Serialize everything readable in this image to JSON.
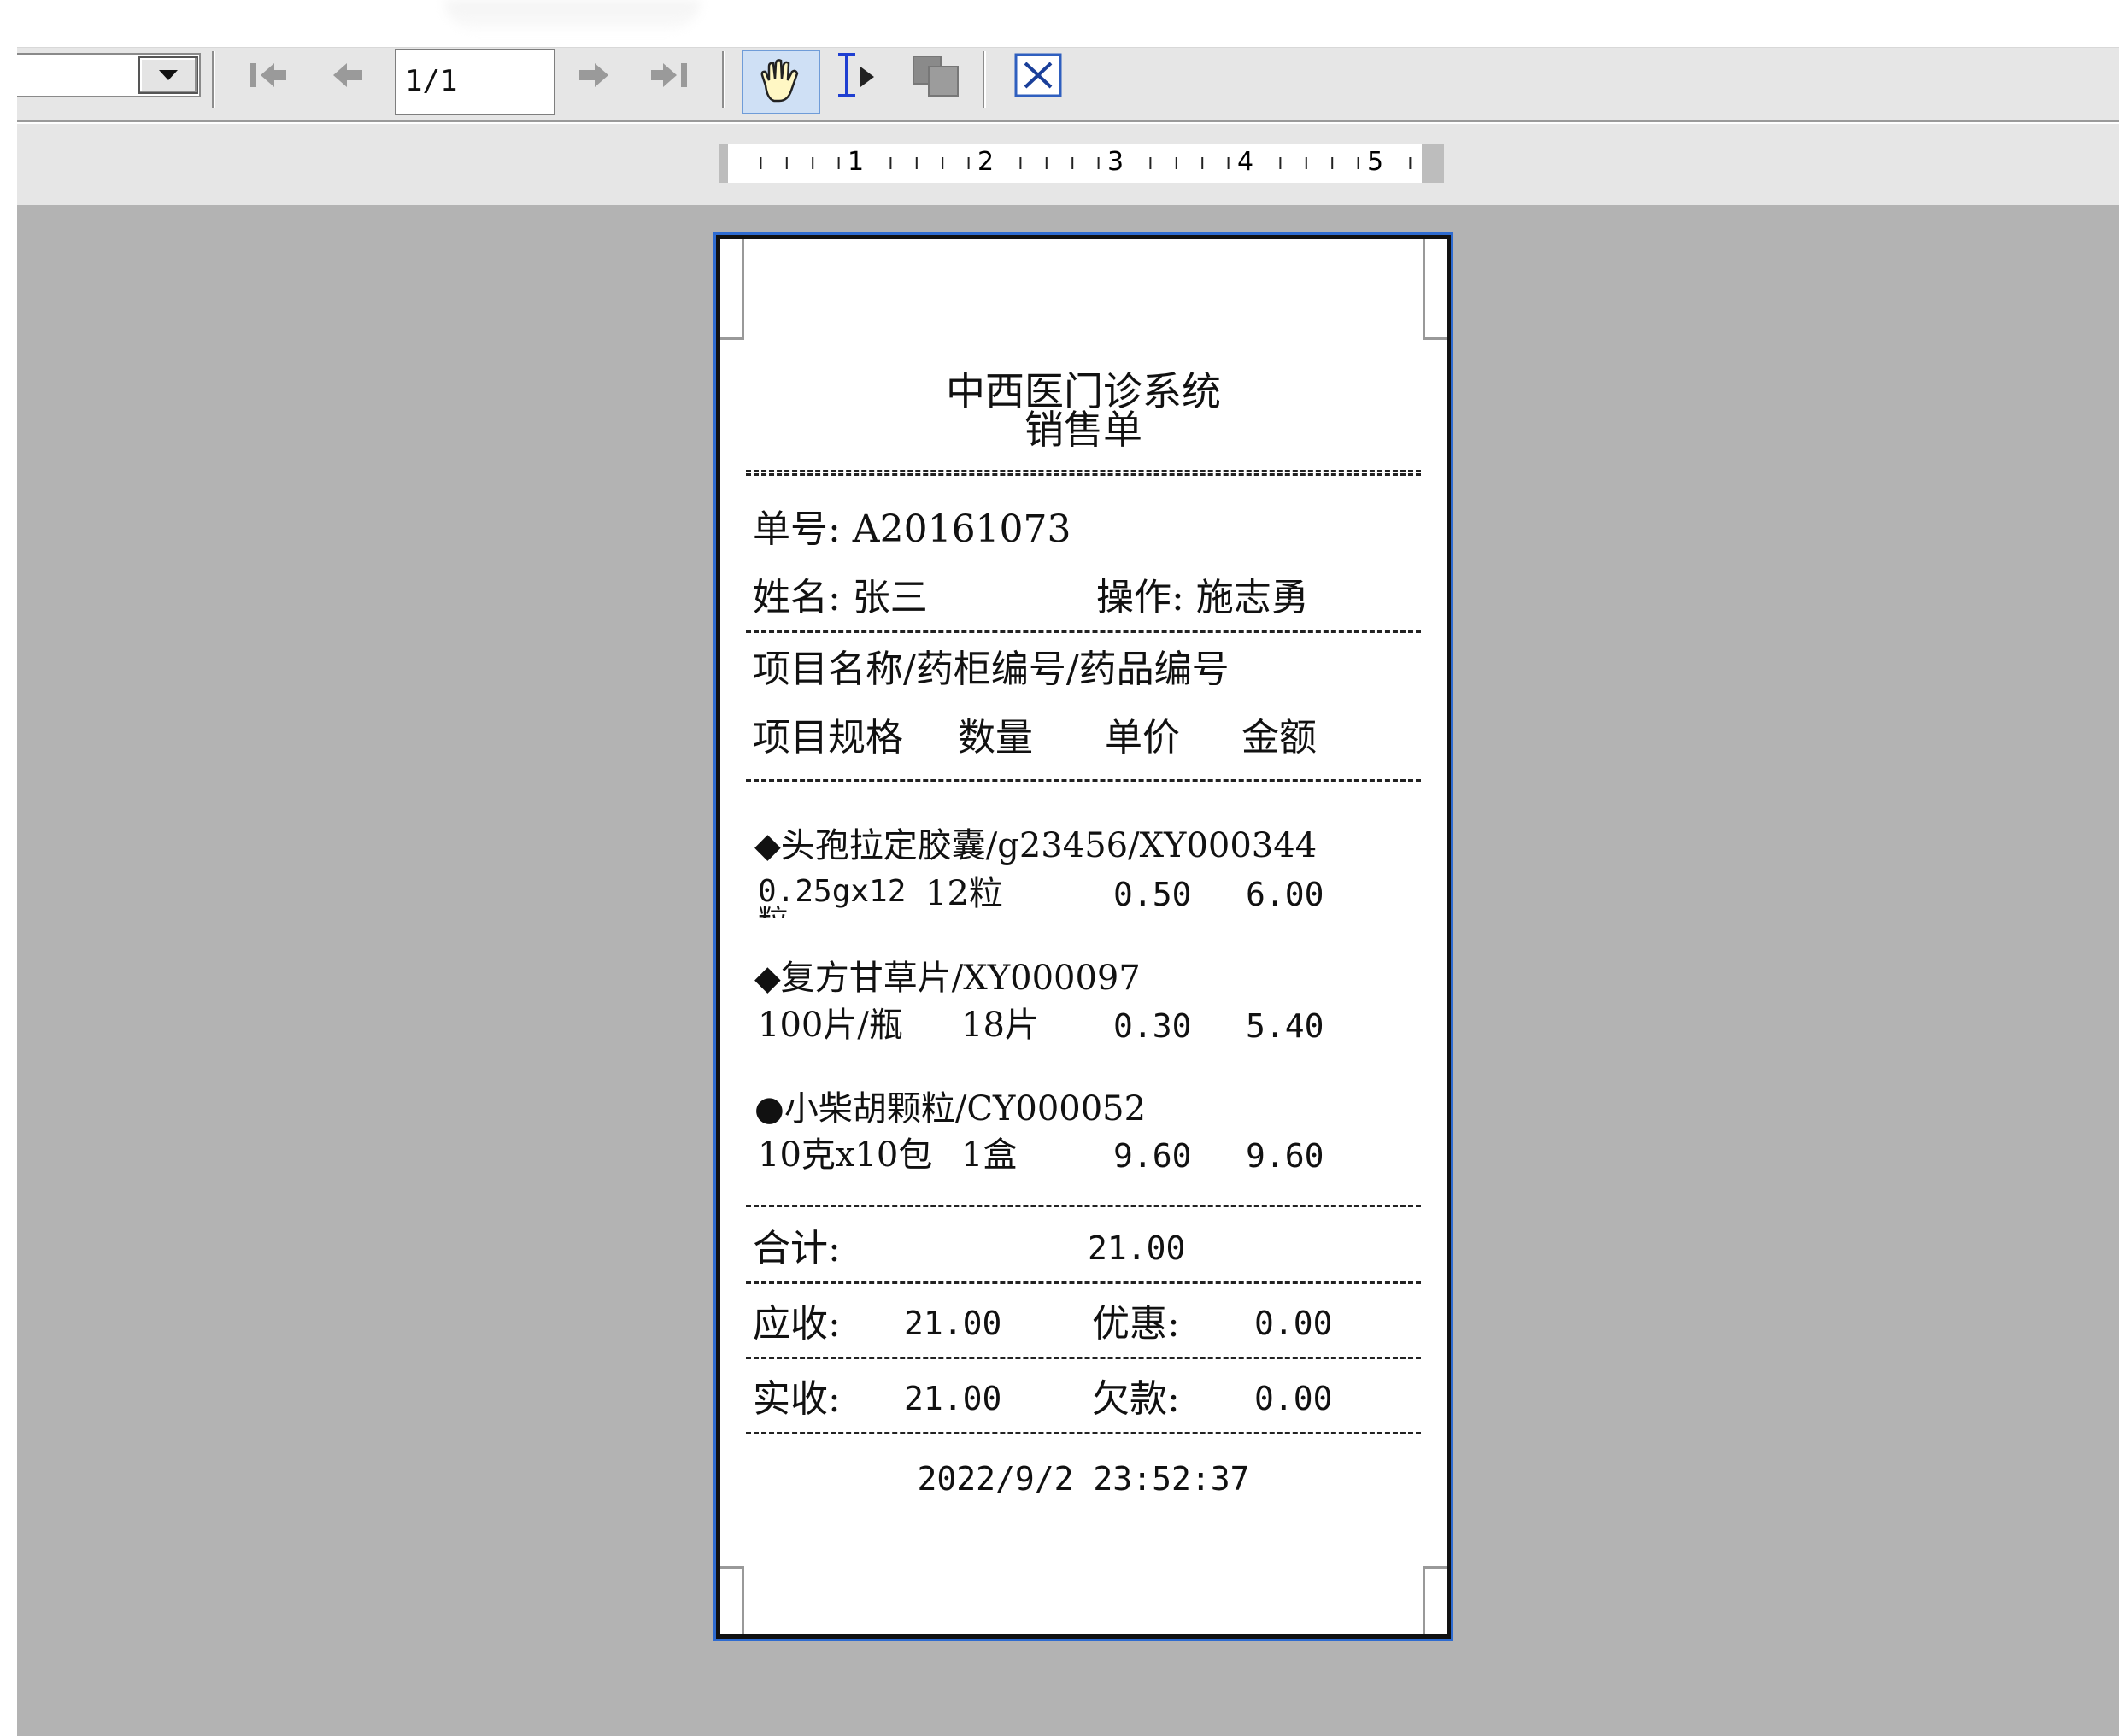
{
  "toolbar": {
    "page_indicator": "1/1",
    "icons": [
      "chevron-down-icon",
      "first-page-icon",
      "prev-page-icon",
      "next-page-icon",
      "last-page-icon",
      "hand-tool-icon",
      "text-select-icon",
      "copy-icon",
      "close-icon"
    ]
  },
  "ruler": {
    "labels": [
      "1",
      "2",
      "3",
      "4",
      "5"
    ]
  },
  "receipt": {
    "title": "中西医门诊系统",
    "subtitle": "销售单",
    "order_no": "单号: A20161073",
    "name_line": "姓名: 张三",
    "operator_line": "操作: 施志勇",
    "header_line1": "项目名称/药柜编号/药品编号",
    "header_spec": "项目规格",
    "header_qty": "数量",
    "header_price": "单价",
    "header_amount": "金额",
    "items": [
      {
        "name": "◆头孢拉定胶囊/g23456/XY000344",
        "spec": "0.25gx12",
        "spec_overflow": "粒",
        "qty": "12粒",
        "price": "0.50",
        "amount": "6.00"
      },
      {
        "name": "◆复方甘草片/XY000097",
        "spec": "100片/瓶",
        "qty": "18片",
        "price": "0.30",
        "amount": "5.40"
      },
      {
        "name": "●小柴胡颗粒/CY000052",
        "spec": "10克x10包",
        "qty": "1盒",
        "price": "9.60",
        "amount": "9.60"
      }
    ],
    "total_label": "合计:",
    "total_value": "21.00",
    "receivable_label": "应收:",
    "receivable_value": "21.00",
    "discount_label": "优惠:",
    "discount_value": "0.00",
    "received_label": "实收:",
    "received_value": "21.00",
    "owed_label": "欠款:",
    "owed_value": "0.00",
    "timestamp": "2022/9/2 23:52:37"
  }
}
